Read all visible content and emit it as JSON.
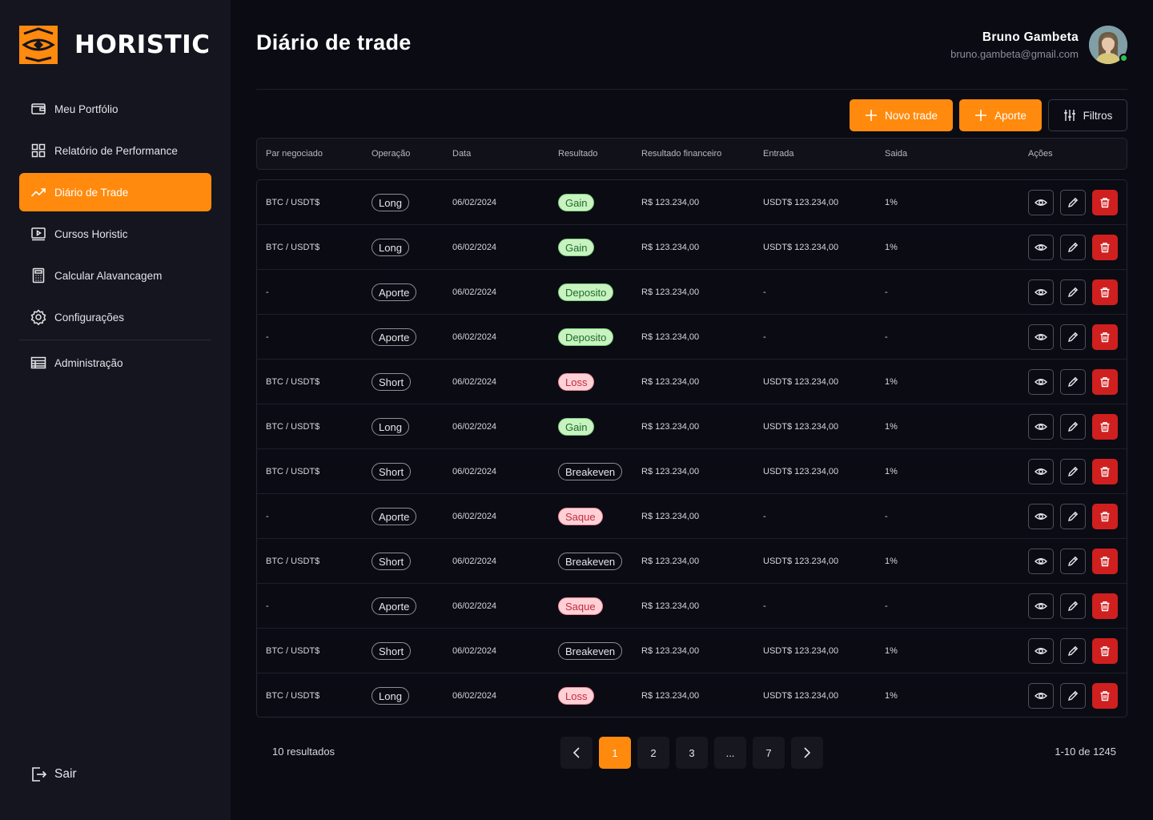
{
  "brand": {
    "name": "HORISTIC",
    "accent": "#ff8a0d"
  },
  "sidebar": {
    "items": [
      {
        "label": "Meu Portfólio",
        "icon": "wallet-icon"
      },
      {
        "label": "Relatório de Performance",
        "icon": "dashboard-grid-icon"
      },
      {
        "label": "Diário de Trade",
        "icon": "trending-up-icon",
        "active": true
      },
      {
        "label": "Cursos Horistic",
        "icon": "video-icon"
      },
      {
        "label": "Calcular Alavancagem",
        "icon": "calculator-icon"
      },
      {
        "label": "Configurações",
        "icon": "gear-icon"
      },
      {
        "label": "Administração",
        "icon": "table-icon"
      }
    ],
    "logout_label": "Sair"
  },
  "header": {
    "title": "Diário de trade",
    "user_name": "Bruno Gambeta",
    "user_email": "bruno.gambeta@gmail.com"
  },
  "toolbar": {
    "new_trade_label": "Novo trade",
    "deposit_label": "Aporte",
    "filters_label": "Filtros"
  },
  "table": {
    "columns": [
      "Par negociado",
      "Operação",
      "Data",
      "Resultado",
      "Resultado financeiro",
      "Entrada",
      "Saida",
      "Ações"
    ],
    "rows": [
      {
        "pair": "BTC / USDT$",
        "operation": "Long",
        "date": "06/02/2024",
        "result": "Gain",
        "financial": "R$ 123.234,00",
        "entry": "USDT$ 123.234,00",
        "exit": "1%"
      },
      {
        "pair": "BTC / USDT$",
        "operation": "Long",
        "date": "06/02/2024",
        "result": "Gain",
        "financial": "R$ 123.234,00",
        "entry": "USDT$ 123.234,00",
        "exit": "1%"
      },
      {
        "pair": "-",
        "operation": "Aporte",
        "date": "06/02/2024",
        "result": "Deposito",
        "financial": "R$ 123.234,00",
        "entry": "-",
        "exit": "-"
      },
      {
        "pair": "-",
        "operation": "Aporte",
        "date": "06/02/2024",
        "result": "Deposito",
        "financial": "R$ 123.234,00",
        "entry": "-",
        "exit": "-"
      },
      {
        "pair": "BTC / USDT$",
        "operation": "Short",
        "date": "06/02/2024",
        "result": "Loss",
        "financial": "R$ 123.234,00",
        "entry": "USDT$ 123.234,00",
        "exit": "1%"
      },
      {
        "pair": "BTC / USDT$",
        "operation": "Long",
        "date": "06/02/2024",
        "result": "Gain",
        "financial": "R$ 123.234,00",
        "entry": "USDT$ 123.234,00",
        "exit": "1%"
      },
      {
        "pair": "BTC / USDT$",
        "operation": "Short",
        "date": "06/02/2024",
        "result": "Breakeven",
        "financial": "R$ 123.234,00",
        "entry": "USDT$ 123.234,00",
        "exit": "1%"
      },
      {
        "pair": "-",
        "operation": "Aporte",
        "date": "06/02/2024",
        "result": "Saque",
        "financial": "R$ 123.234,00",
        "entry": "-",
        "exit": "-"
      },
      {
        "pair": "BTC / USDT$",
        "operation": "Short",
        "date": "06/02/2024",
        "result": "Breakeven",
        "financial": "R$ 123.234,00",
        "entry": "USDT$ 123.234,00",
        "exit": "1%"
      },
      {
        "pair": "-",
        "operation": "Aporte",
        "date": "06/02/2024",
        "result": "Saque",
        "financial": "R$ 123.234,00",
        "entry": "-",
        "exit": "-"
      },
      {
        "pair": "BTC / USDT$",
        "operation": "Short",
        "date": "06/02/2024",
        "result": "Breakeven",
        "financial": "R$ 123.234,00",
        "entry": "USDT$ 123.234,00",
        "exit": "1%"
      },
      {
        "pair": "BTC / USDT$",
        "operation": "Long",
        "date": "06/02/2024",
        "result": "Loss",
        "financial": "R$ 123.234,00",
        "entry": "USDT$ 123.234,00",
        "exit": "1%"
      }
    ]
  },
  "footer": {
    "results_count": "10 resultados",
    "pages": [
      "1",
      "2",
      "3",
      "...",
      "7"
    ],
    "current_page": "1",
    "range": "1-10 de 1245"
  }
}
